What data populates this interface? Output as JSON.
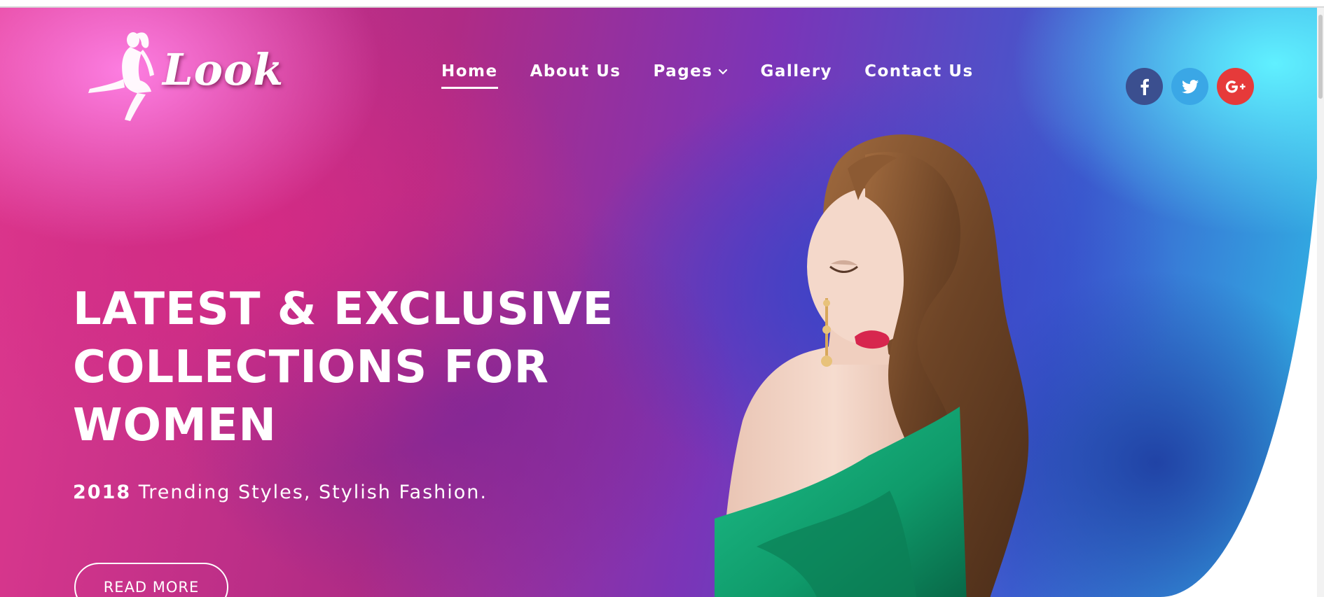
{
  "brand": {
    "logo_text": "Look"
  },
  "nav": {
    "items": [
      {
        "label": "Home",
        "active": true
      },
      {
        "label": "About Us",
        "active": false
      },
      {
        "label": "Pages",
        "active": false,
        "has_dropdown": true
      },
      {
        "label": "Gallery",
        "active": false
      },
      {
        "label": "Contact Us",
        "active": false
      }
    ]
  },
  "social": [
    {
      "name": "facebook",
      "glyph": "f",
      "color": "#3b4f8f"
    },
    {
      "name": "twitter",
      "glyph": "t",
      "color": "#3aa7e6"
    },
    {
      "name": "google-plus",
      "glyph": "G+",
      "color": "#e63a3a"
    }
  ],
  "hero": {
    "headline_lines": [
      "LATEST & EXCLUSIVE",
      "COLLECTIONS FOR",
      "WOMEN"
    ],
    "subline_year": "2018",
    "subline_text": " Trending Styles, Stylish Fashion.",
    "cta_label": "READ MORE"
  },
  "colors": {
    "text": "#ffffff",
    "dress": "#0f9a6a",
    "hair": "#7a4e2c",
    "skin": "#f1d3c4",
    "lips": "#d7264e"
  }
}
